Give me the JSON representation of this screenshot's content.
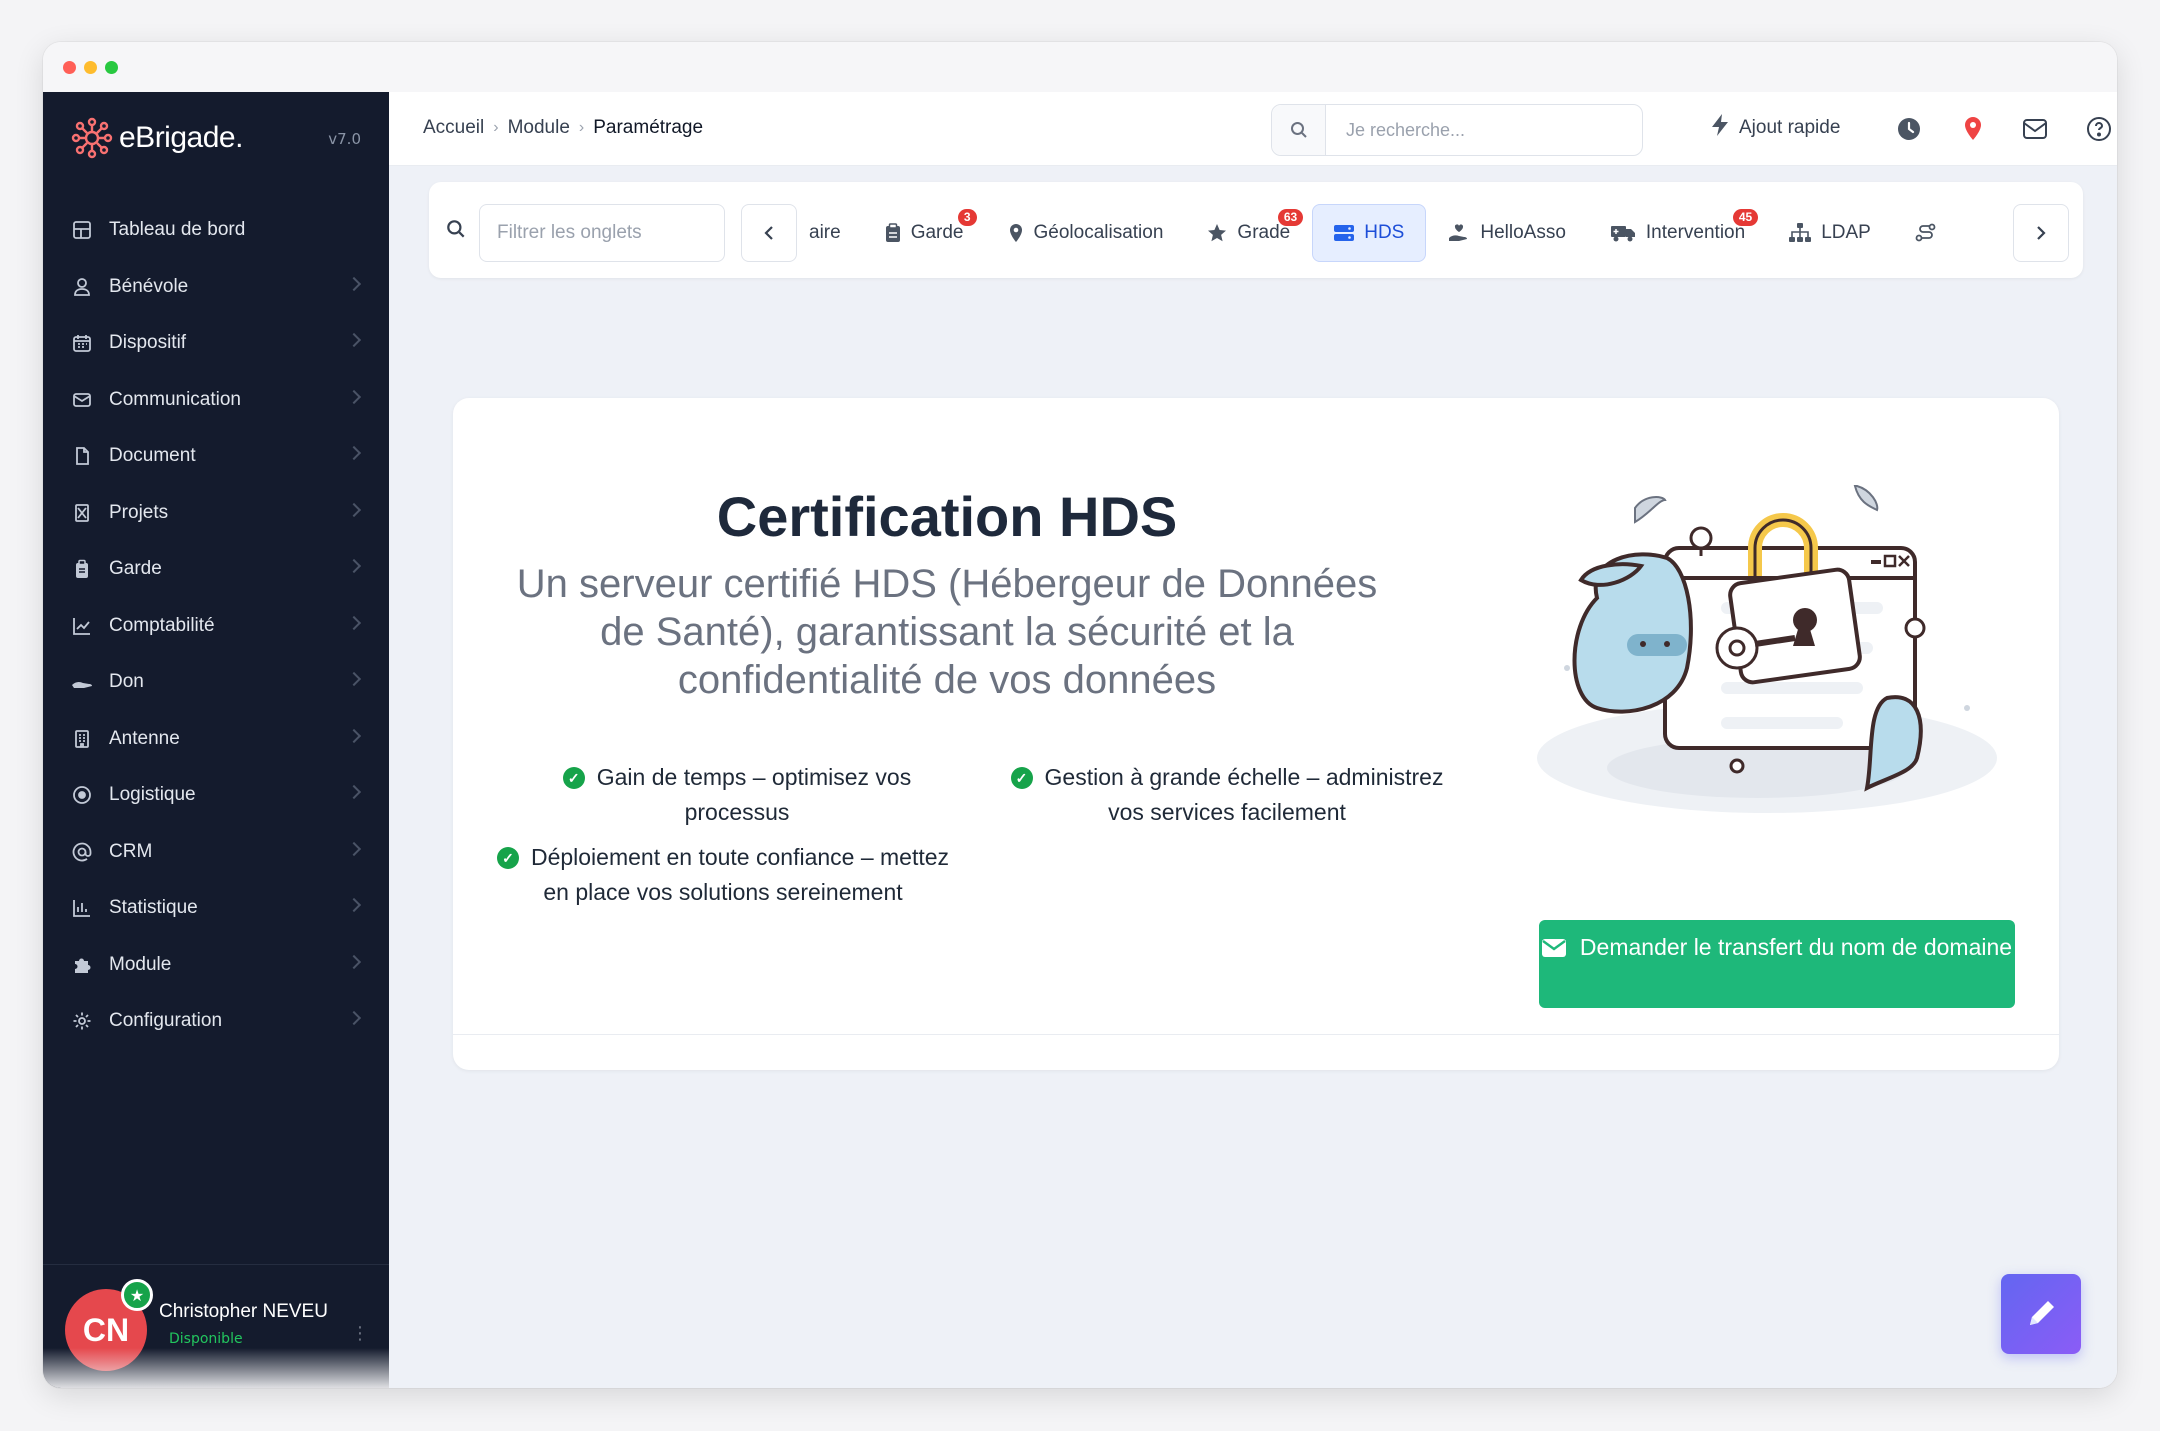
{
  "app": {
    "logo_text": "eBrigade.",
    "version": "v7.0"
  },
  "sidebar": {
    "items": [
      {
        "label": "Tableau de bord",
        "icon": "dashboard-icon"
      },
      {
        "label": "Bénévole",
        "icon": "user-icon"
      },
      {
        "label": "Dispositif",
        "icon": "calendar-icon"
      },
      {
        "label": "Communication",
        "icon": "mail-icon"
      },
      {
        "label": "Document",
        "icon": "file-icon"
      },
      {
        "label": "Projets",
        "icon": "project-icon"
      },
      {
        "label": "Garde",
        "icon": "clipboard-icon"
      },
      {
        "label": "Comptabilité",
        "icon": "chart-line-icon"
      },
      {
        "label": "Don",
        "icon": "hand-icon"
      },
      {
        "label": "Antenne",
        "icon": "building-icon"
      },
      {
        "label": "Logistique",
        "icon": "target-icon"
      },
      {
        "label": "CRM",
        "icon": "at-icon"
      },
      {
        "label": "Statistique",
        "icon": "bar-chart-icon"
      },
      {
        "label": "Module",
        "icon": "puzzle-icon"
      },
      {
        "label": "Configuration",
        "icon": "gear-icon"
      }
    ]
  },
  "user": {
    "initials": "CN",
    "name": "Christopher NEVEU",
    "status": "Disponible",
    "status_color": "#22c55e"
  },
  "header": {
    "breadcrumb": [
      "Accueil",
      "Module",
      "Paramétrage"
    ],
    "search_placeholder": "Je recherche...",
    "quick_add": "Ajout rapide"
  },
  "tabbar": {
    "filter_placeholder": "Filtrer les onglets",
    "tabs": [
      {
        "label": "aire",
        "icon": "",
        "badge": ""
      },
      {
        "label": "Garde",
        "icon": "clipboard-icon",
        "badge": "3"
      },
      {
        "label": "Géolocalisation",
        "icon": "map-pin-icon",
        "badge": ""
      },
      {
        "label": "Grade",
        "icon": "star-icon",
        "badge": "63"
      },
      {
        "label": "HDS",
        "icon": "server-icon",
        "badge": "",
        "active": true
      },
      {
        "label": "HelloAsso",
        "icon": "hand-heart-icon",
        "badge": ""
      },
      {
        "label": "Intervention",
        "icon": "truck-icon",
        "badge": "45"
      },
      {
        "label": "LDAP",
        "icon": "sitemap-icon",
        "badge": ""
      }
    ]
  },
  "main": {
    "title": "Certification HDS",
    "subtitle": "Un serveur certifié HDS (Hébergeur de Données de Santé), garantissant la sécurité et la confidentialité de vos données",
    "features": [
      "Gain de temps – optimisez vos processus",
      "Gestion à grande échelle – administrez vos services facilement",
      "Déploiement en toute confiance – mettez en place vos solutions sereinement"
    ],
    "cta_label": "Demander le transfert du nom de domaine"
  },
  "colors": {
    "sidebar_bg": "#141b2d",
    "accent_green": "#1eb87a",
    "active_tab": "#1d4ed8",
    "badge_red": "#e53935"
  }
}
